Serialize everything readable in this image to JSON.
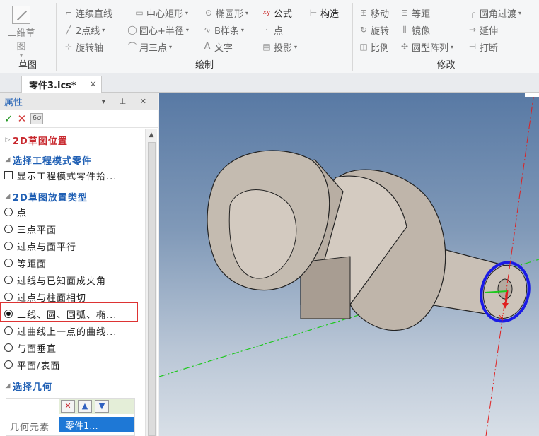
{
  "ribbon": {
    "sketch_group": {
      "big_button": "二维草图",
      "label": "草图"
    },
    "draw_group": {
      "label": "绘制",
      "items": [
        "连续直线",
        "中心矩形",
        "椭圆形",
        "公式",
        "构造",
        "2点线",
        "圆心+半径",
        "B样条",
        "点",
        "旋转轴",
        "用三点",
        "文字",
        "投影"
      ]
    },
    "modify_group": {
      "label": "修改",
      "items": [
        "移动",
        "等距",
        "圆角过渡",
        "旋转",
        "镜像",
        "延伸",
        "比例",
        "圆型阵列",
        "打断"
      ]
    }
  },
  "tab": {
    "title": "零件3.ics*",
    "close": "×"
  },
  "panel": {
    "title": "属性",
    "controls": "▾ ⊥ ✕",
    "sections": {
      "placement": "2D草图位置",
      "select_part": "选择工程模式零件",
      "show_part": "显示工程模式零件拾...",
      "placement_type": "2D草图放置类型",
      "select_geo": "选择几何"
    },
    "options": [
      "点",
      "三点平面",
      "过点与面平行",
      "等距面",
      "过线与已知面成夹角",
      "过点与柱面相切",
      "二线、圆、圆弧、椭...",
      "过曲线上一点的曲线...",
      "与面垂直",
      "平面/表面"
    ],
    "selected_option": "二线、圆、圆弧、椭...",
    "geometry": {
      "label": "几何元素",
      "selected": "零件1..."
    }
  },
  "colors": {
    "accent": "#1f5fb4",
    "highlight_box": "#dd3333",
    "section_red": "#c8282e",
    "selection": "#1e78d6",
    "circle": "#1a1ae6"
  }
}
